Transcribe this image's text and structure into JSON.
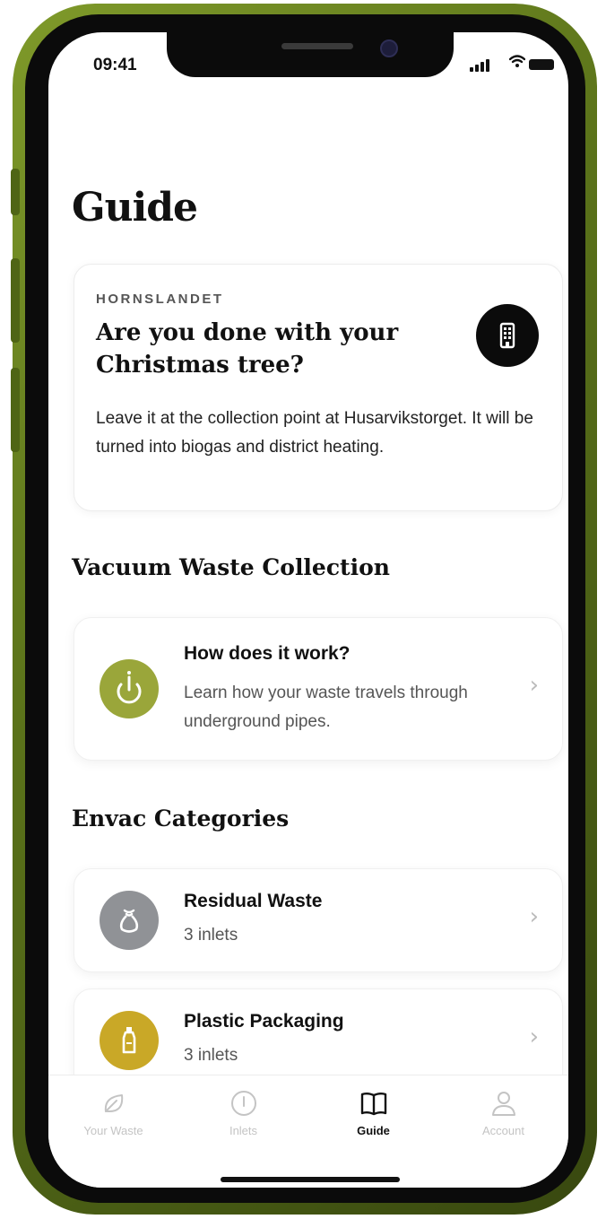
{
  "status": {
    "time": "09:41"
  },
  "page": {
    "title": "Guide"
  },
  "notice": {
    "area": "HORNSLANDET",
    "title": "Are you done with your Christmas tree?",
    "body": "Leave it at the collection point at Husarvikstorget. It will be turned into biogas and district heating.",
    "icon": "building-icon"
  },
  "vacuum_section": {
    "title": "Vacuum Waste Collection",
    "item": {
      "title": "How does it work?",
      "subtitle": "Learn how your waste travels through underground pipes.",
      "icon": "power-icon",
      "icon_color": "#9aa63a"
    }
  },
  "categories_section": {
    "title": "Envac Categories",
    "items": [
      {
        "title": "Residual Waste",
        "subtitle": "3 inlets",
        "icon": "waste-bag-icon",
        "icon_color": "#909296"
      },
      {
        "title": "Plastic Packaging",
        "subtitle": "3 inlets",
        "icon": "bottle-icon",
        "icon_color": "#c9a827"
      }
    ]
  },
  "tabs": [
    {
      "label": "Your Waste",
      "icon": "leaf-icon",
      "active": false
    },
    {
      "label": "Inlets",
      "icon": "inlet-icon",
      "active": false
    },
    {
      "label": "Guide",
      "icon": "book-icon",
      "active": true
    },
    {
      "label": "Account",
      "icon": "person-icon",
      "active": false
    }
  ],
  "colors": {
    "frame": "#5b731a",
    "accent_olive": "#9aa63a",
    "accent_gold": "#c9a827",
    "dark": "#0b0b0b"
  }
}
